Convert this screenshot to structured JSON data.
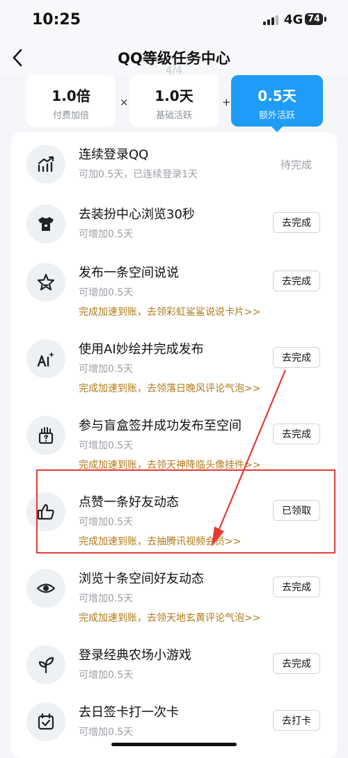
{
  "status_bar": {
    "time": "10:25",
    "network": "4G",
    "battery": "74"
  },
  "nav": {
    "title": "QQ等级任务中心",
    "ghost_text": "4/4"
  },
  "multipliers": [
    {
      "value": "1.0倍",
      "label": "付费加倍",
      "active": false
    },
    {
      "value": "1.0天",
      "label": "基础活跃",
      "active": false
    },
    {
      "value": "0.5天",
      "label": "额外活跃",
      "active": true
    }
  ],
  "operators": [
    "×",
    "+"
  ],
  "tasks": [
    {
      "title": "连续登录QQ",
      "sub": "可加0.5天，已连续登录1天",
      "promo": "",
      "action": "待完成",
      "action_type": "text",
      "icon": "trend-chart-icon"
    },
    {
      "title": "去装扮中心浏览30秒",
      "sub": "可增加0.5天",
      "promo": "",
      "action": "去完成",
      "action_type": "button",
      "icon": "tshirt-icon"
    },
    {
      "title": "发布一条空间说说",
      "sub": "可增加0.5天",
      "promo": "完成加速到账，去领彩虹鲨鲨说说卡片>>",
      "action": "去完成",
      "action_type": "button",
      "icon": "star-icon"
    },
    {
      "title": "使用AI妙绘并完成发布",
      "sub": "可增加0.5天",
      "promo": "完成加速到账，去领落日晚风评论气泡>>",
      "action": "去完成",
      "action_type": "button",
      "icon": "ai-draw-icon"
    },
    {
      "title": "参与盲盒签并成功发布至空间",
      "sub": "可增加0.5天",
      "promo": "完成加速到账，去领天神降临头像挂件>>",
      "action": "去完成",
      "action_type": "button",
      "icon": "blind-box-icon"
    },
    {
      "title": "点赞一条好友动态",
      "sub": "可增加0.5天",
      "promo": "完成加速到账，去抽腾讯视频会员>>",
      "action": "已领取",
      "action_type": "button",
      "icon": "thumbs-up-icon"
    },
    {
      "title": "浏览十条空间好友动态",
      "sub": "可增加0.5天",
      "promo": "完成加速到账，去领天地玄黄评论气泡>>",
      "action": "去完成",
      "action_type": "button",
      "icon": "eye-icon"
    },
    {
      "title": "登录经典农场小游戏",
      "sub": "可增加0.5天",
      "promo": "",
      "action": "去完成",
      "action_type": "button",
      "icon": "sprout-icon"
    },
    {
      "title": "去日签卡打一次卡",
      "sub": "可增加0.5天",
      "promo": "",
      "action": "去打卡",
      "action_type": "button",
      "icon": "calendar-check-icon"
    }
  ],
  "annotation": {
    "color": "#e53935"
  },
  "colors": {
    "accent": "#1e9cf8",
    "promo": "#b07a18",
    "muted": "#9a9ea6"
  }
}
